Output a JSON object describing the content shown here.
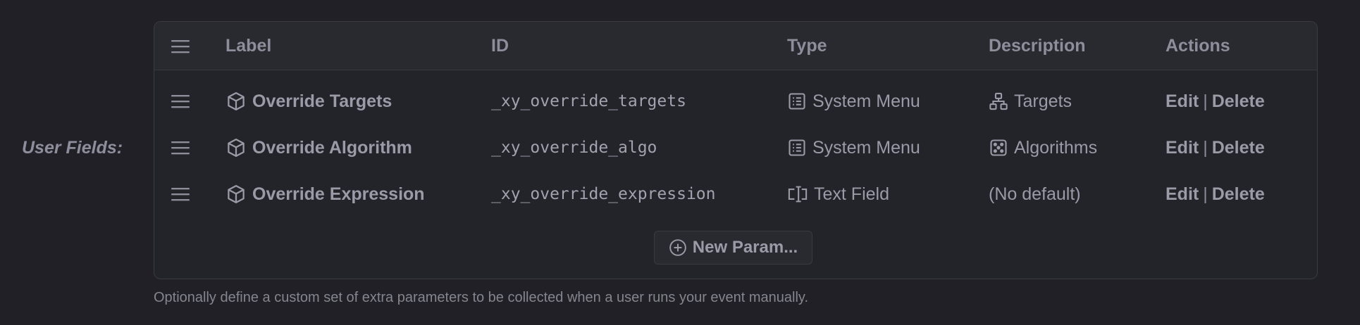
{
  "field_label": "User Fields:",
  "columns": {
    "label": "Label",
    "id": "ID",
    "type": "Type",
    "description": "Description",
    "actions": "Actions"
  },
  "rows": [
    {
      "label": "Override Targets",
      "id": "_xy_override_targets",
      "type": "System Menu",
      "type_icon": "list-icon",
      "description": "Targets",
      "description_icon": "sitemap-icon",
      "edit": "Edit",
      "separator": "|",
      "delete": "Delete"
    },
    {
      "label": "Override Algorithm",
      "id": "_xy_override_algo",
      "type": "System Menu",
      "type_icon": "list-icon",
      "description": "Algorithms",
      "description_icon": "dice-icon",
      "edit": "Edit",
      "separator": "|",
      "delete": "Delete"
    },
    {
      "label": "Override Expression",
      "id": "_xy_override_expression",
      "type": "Text Field",
      "type_icon": "text-field-icon",
      "description": "(No default)",
      "description_icon": "",
      "edit": "Edit",
      "separator": "|",
      "delete": "Delete"
    }
  ],
  "new_button": "New Param...",
  "hint": "Optionally define a custom set of extra parameters to be collected when a user runs your event manually.",
  "colors": {
    "background": "#202026",
    "table_bg": "#23232a",
    "header_bg": "#292930",
    "text": "#9b9ba8"
  }
}
